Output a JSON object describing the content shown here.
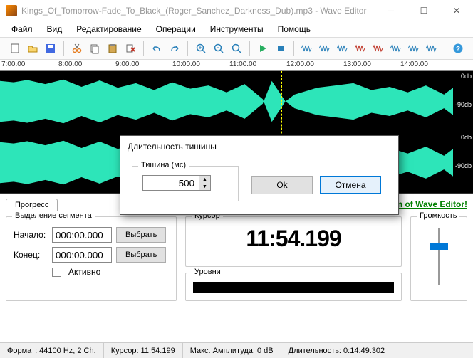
{
  "window": {
    "title": "Kings_Of_Tomorrow-Fade_To_Black_(Roger_Sanchez_Darkness_Dub).mp3 - Wave Editor"
  },
  "menu": {
    "file": "Файл",
    "view": "Вид",
    "edit": "Редактирование",
    "ops": "Операции",
    "tools": "Инструменты",
    "help": "Помощь"
  },
  "ruler": {
    "t0": "7:00.00",
    "t1": "8:00.00",
    "t2": "9:00.00",
    "t3": "10:00.00",
    "t4": "11:00.00",
    "t5": "12:00.00",
    "t6": "13:00.00",
    "t7": "14:00.00"
  },
  "db": {
    "zero": "0db",
    "ninety": "-90db"
  },
  "dialog": {
    "title": "Длительность тишины",
    "field_label": "Тишина (мс)",
    "value": "500",
    "ok": "Ok",
    "cancel": "Отмена"
  },
  "tabs": {
    "progress": "Прогресс"
  },
  "promo": "Try an advanced version of Wave Editor!",
  "segment": {
    "legend": "Выделение сегмента",
    "start_label": "Начало:",
    "end_label": "Конец:",
    "start": "000:00.000",
    "end": "000:00.000",
    "select": "Выбрать",
    "active": "Активно"
  },
  "cursor": {
    "legend": "Курсор",
    "value": "11:54.199"
  },
  "levels": {
    "legend": "Уровни"
  },
  "volume": {
    "legend": "Громкость"
  },
  "status": {
    "format": "Формат: 44100 Hz, 2 Ch.",
    "cursor": "Курсор: 11:54.199",
    "amp": "Макс. Амплитуда: 0 dB",
    "duration": "Длительность: 0:14:49.302"
  }
}
